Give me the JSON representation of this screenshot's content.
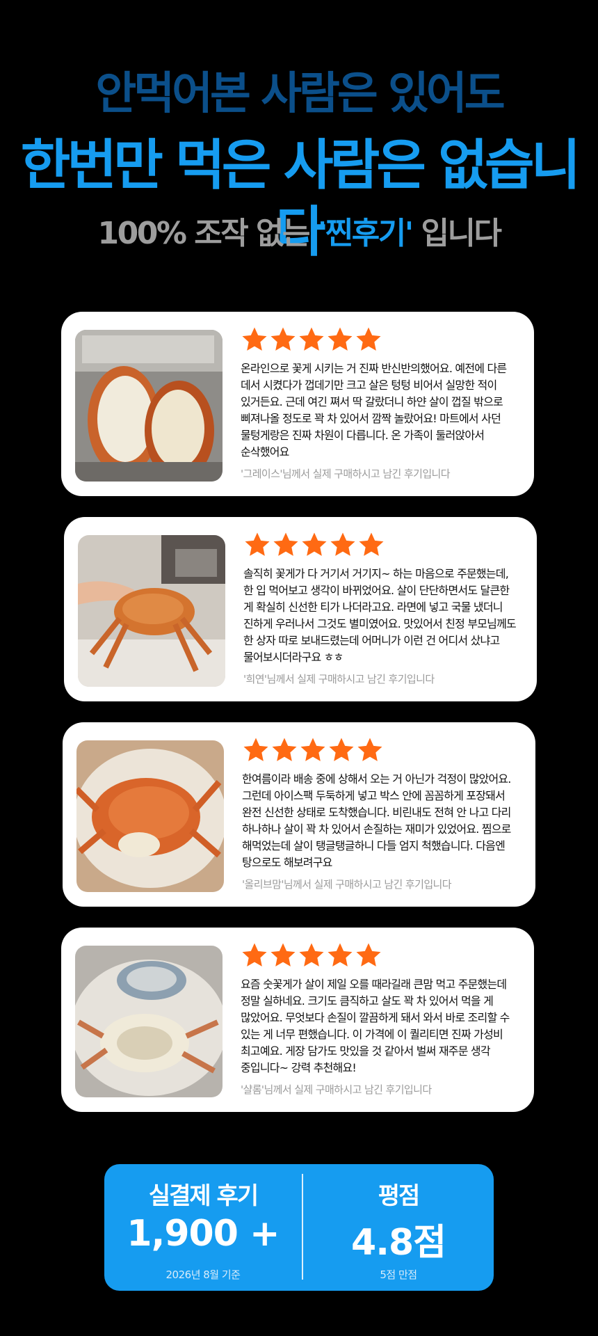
{
  "hero": {
    "line1": "안먹어본 사람은 있어도",
    "line2": "한번만 먹은 사람은 없습니다",
    "line3_prefix": "100% 조작 없는 ",
    "line3_highlight": "'찐후기'",
    "line3_suffix": " 입니다"
  },
  "colors": {
    "background": "#000000",
    "accent": "#169cf0",
    "headline_dark_blue": "#0b4f8a",
    "star": "#ff6a13",
    "subtitle_gray": "#9d9d9d"
  },
  "reviews": [
    {
      "rating": 5,
      "text": "온라인으로 꽃게 시키는 거 진짜 반신반의했어요. 예전에 다른 데서 시켰다가 껍데기만 크고 살은 텅텅 비어서 실망한 적이 있거든요. 근데 여긴 쪄서 딱 갈랐더니 하얀 살이 껍질 밖으로 삐져나올 정도로 꽉 차 있어서 깜짝 놀랐어요! 마트에서 사던 물텅게랑은 진짜 차원이 다릅니다. 온 가족이 둘러앉아서 순삭했어요",
      "author": "'그레이스'님께서 실제 구매하시고 남긴 후기입니다",
      "photo_icon": "crab-halves-photo"
    },
    {
      "rating": 5,
      "text": "솔직히 꽃게가 다 거기서 거기지~ 하는 마음으로 주문했는데, 한 입 먹어보고 생각이 바뀌었어요. 살이 단단하면서도 달큰한 게 확실히 신선한 티가 나더라고요. 라면에 넣고 국물 냈더니 진하게 우러나서 그것도 별미였어요. 맛있어서 친정 부모님께도 한 상자 따로 보내드렸는데 어머니가 이런 건 어디서 샀냐고 물어보시더라구요 ㅎㅎ",
      "author": "'희연'님께서 실제 구매하시고 남긴 후기입니다",
      "photo_icon": "hand-holding-crab-photo"
    },
    {
      "rating": 5,
      "text": "한여름이라 배송 중에 상해서 오는 거 아닌가 걱정이 많았어요. 그런데 아이스팩 두둑하게 넣고 박스 안에 꼼꼼하게 포장돼서 완전 신선한 상태로 도착했습니다. 비린내도 전혀 안 나고 다리 하나하나 살이 꽉 차 있어서 손질하는 재미가 있었어요. 찜으로 해먹었는데 살이 탱글탱글하니 다들 엄지 척했습니다. 다음엔 탕으로도 해보려구요",
      "author": "'올리브맘'님께서 실제 구매하시고 남긴 후기입니다",
      "photo_icon": "steamed-crab-plate-photo"
    },
    {
      "rating": 5,
      "text": "요즘 숫꽃게가 살이 제일 오를 때라길래 큰맘 먹고 주문했는데 정말 실하네요. 크기도 큼직하고 살도 꽉 차 있어서 먹을 게 많았어요. 무엇보다 손질이 깔끔하게 돼서 와서 바로 조리할 수 있는 게 너무 편했습니다. 이 가격에 이 퀄리티면 진짜 가성비 최고예요. 게장 담가도 맛있을 것 같아서 벌써 재주문 생각 중입니다~ 강력 추천해요!",
      "author": "'샬롬'님께서 실제 구매하시고 남긴 후기입니다",
      "photo_icon": "opened-crab-plate-photo"
    }
  ],
  "stats": {
    "reviews_label": "실결제 후기",
    "reviews_value": "1,900 +",
    "reviews_note": "2026년 8월 기준",
    "rating_label": "평점",
    "rating_value": "4.8점",
    "rating_note": "5점 만점"
  }
}
